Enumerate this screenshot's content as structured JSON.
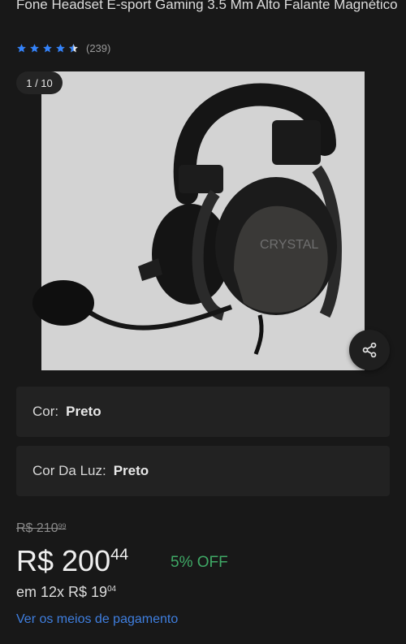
{
  "product": {
    "title": "Fone Headset  E-sport Gaming 3.5 Mm Alto Falante Magnético",
    "rating_value": 4.5,
    "reviews_count": "(239)"
  },
  "gallery": {
    "pager": "1 / 10",
    "image_alt": "headset",
    "watermark": "CRYSTAL"
  },
  "variants": [
    {
      "label": "Cor:",
      "value": "Preto"
    },
    {
      "label": "Cor Da Luz:",
      "value": "Preto"
    }
  ],
  "pricing": {
    "old_currency_int": "R$ 210",
    "old_cents": "99",
    "price_int": "R$ 200",
    "price_cents": "44",
    "discount": "5% OFF",
    "installments_prefix": "em 12x R$ 19",
    "installments_cents": "04",
    "payment_link": "Ver os meios de pagamento"
  },
  "colors": {
    "star": "#3483fa",
    "discount": "#3fa966",
    "link": "#3f7fe0"
  },
  "icons": {
    "share": "share-icon",
    "star": "star-icon"
  }
}
